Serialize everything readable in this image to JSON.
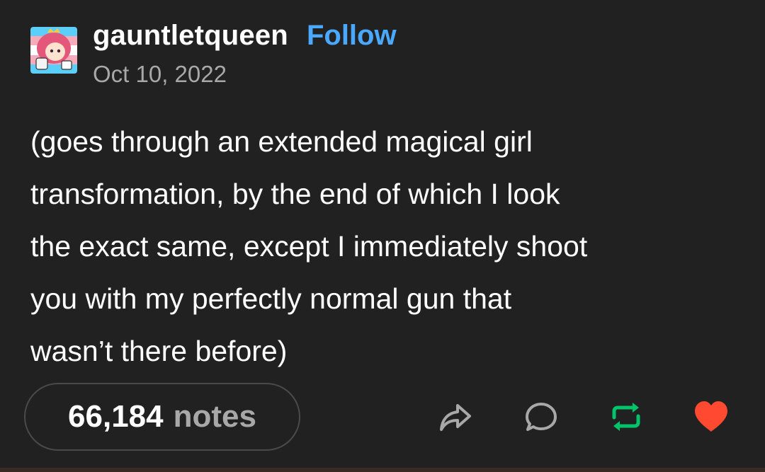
{
  "post": {
    "username": "gauntletqueen",
    "follow_label": "Follow",
    "date": "Oct 10, 2022",
    "body": "(goes through an extended magical girl\ntransformation, by the end of which I look\nthe exact same, except I immediately shoot\nyou with my perfectly normal gun that\nwasn’t there before)",
    "notes_count": "66,184",
    "notes_label": "notes"
  },
  "icons": {
    "share": "share-arrow-icon",
    "reply": "reply-bubble-icon",
    "reblog": "reblog-icon",
    "like": "heart-icon"
  },
  "colors": {
    "background": "#212121",
    "follow": "#4aa8ff",
    "reblog": "#00c46a",
    "like": "#ff4930",
    "muted": "#a8a8a8"
  }
}
